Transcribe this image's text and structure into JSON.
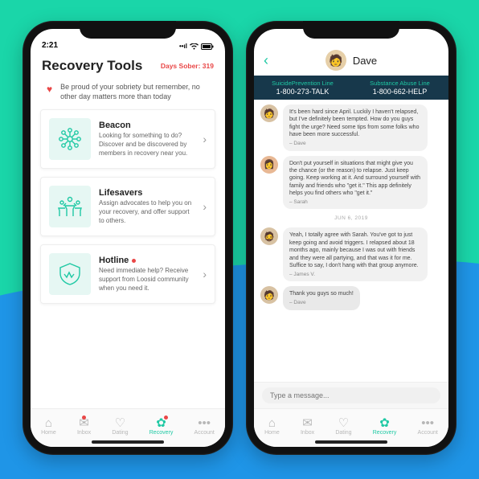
{
  "statusbar": {
    "time": "2:21",
    "signal": "••ıl",
    "wifi": "📶",
    "battery": "■"
  },
  "phone1": {
    "title": "Recovery Tools",
    "days_sober": "Days Sober: 319",
    "banner": "Be proud of your sobriety but remember, no other day matters more than today",
    "cards": [
      {
        "title": "Beacon",
        "desc": "Looking for something to do? Discover and be discovered by members in recovery near you.",
        "hot": false
      },
      {
        "title": "Lifesavers",
        "desc": "Assign advocates to help you on your recovery, and offer support to others.",
        "hot": false
      },
      {
        "title": "Hotline",
        "desc": "Need immediate help? Receive support from Loosid community when you need it.",
        "hot": true
      }
    ]
  },
  "tabs": [
    {
      "label": "Home"
    },
    {
      "label": "Inbox"
    },
    {
      "label": "Dating"
    },
    {
      "label": "Recovery"
    },
    {
      "label": "Account"
    }
  ],
  "phone2": {
    "name": "Dave",
    "lines": [
      {
        "label": "SuicidePrevention Line",
        "number": "1-800-273-TALK"
      },
      {
        "label": "Substance Abuse Line",
        "number": "1-800-662-HELP"
      }
    ],
    "date": "JUN 6, 2019",
    "messages": [
      {
        "author": "Dave",
        "female": false,
        "text": "It's been hard since April. Luckily I haven't relapsed, but I've definitely been tempted. How do you guys fight the urge? Need some tips from some folks who have been more successful."
      },
      {
        "author": "Sarah",
        "female": true,
        "text": "Don't put yourself in situations that might give you the chance (or the reason) to relapse. Just keep going. Keep working at it. And surround yourself with family and friends who \"get it.\" This app definitely helps you find others who \"get it.\""
      },
      {
        "author": "James V.",
        "female": false,
        "text": "Yeah, I totally agree with Sarah. You've got to just keep going and avoid triggers. I relapsed about 18 months ago, mainly because I was out with friends and they were all partying, and that was it for me. Suffice to say, I don't hang with that group anymore."
      },
      {
        "author": "Dave",
        "female": false,
        "text": "Thank you guys so much!"
      }
    ],
    "composer_placeholder": "Type a message..."
  }
}
